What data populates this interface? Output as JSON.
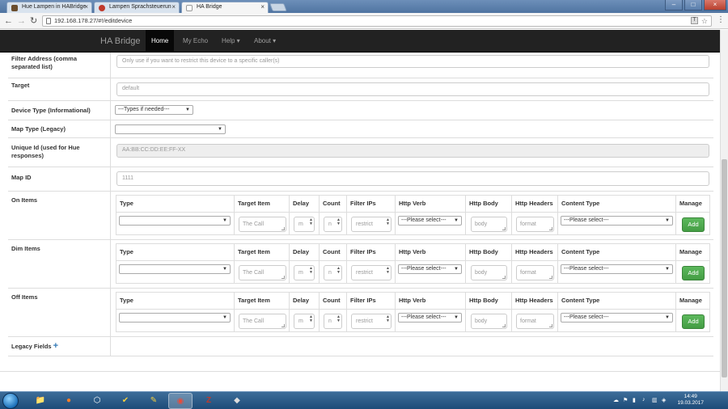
{
  "browser": {
    "tabs": [
      {
        "title": "Hue Lampen in HABridge",
        "fav_color": "#6b4e2e"
      },
      {
        "title": "Lampen Sprachsteuerun",
        "fav_color": "#c0392b"
      },
      {
        "title": "HA Bridge",
        "fav_color": "#aaaaaa"
      }
    ],
    "url": "192.168.178.27/#!/editdevice",
    "close_tab_glyph": "×"
  },
  "app": {
    "brand": "HA Bridge",
    "nav": [
      {
        "label": "Home"
      },
      {
        "label": "My Echo"
      },
      {
        "label": "Help ▾"
      },
      {
        "label": "About ▾"
      }
    ]
  },
  "form": {
    "filter_address": {
      "label": "Filter Address (comma separated list)",
      "placeholder": "Only use if you want to restrict this device to a specific caller(s)"
    },
    "target": {
      "label": "Target",
      "placeholder": "default"
    },
    "device_type": {
      "label": "Device Type (Informational)",
      "selected": "---Types if needed---"
    },
    "map_type": {
      "label": "Map Type (Legacy)",
      "selected": ""
    },
    "unique_id": {
      "label": "Unique Id (used for Hue responses)",
      "value": "AA:BB:CC:DD:EE:FF-XX"
    },
    "map_id": {
      "label": "Map ID",
      "value": "1111"
    },
    "legacy_label": "Legacy Fields"
  },
  "item_columns": [
    "Type",
    "Target Item",
    "Delay",
    "Count",
    "Filter IPs",
    "Http Verb",
    "Http Body",
    "Http Headers",
    "Content Type",
    "Manage"
  ],
  "item_sections": [
    {
      "label": "On Items"
    },
    {
      "label": "Dim Items"
    },
    {
      "label": "Off Items"
    }
  ],
  "item_row": {
    "type": "",
    "target_placeholder": "The Call",
    "delay_placeholder": "m",
    "count_placeholder": "n",
    "filter_placeholder": "restrict",
    "verb": "---Please select---",
    "body_placeholder": "body",
    "headers_placeholder": "format",
    "content_type": "---Please select---",
    "add_label": "Add"
  },
  "taskbar": {
    "time": "14:49",
    "date": "19.03.2017"
  }
}
